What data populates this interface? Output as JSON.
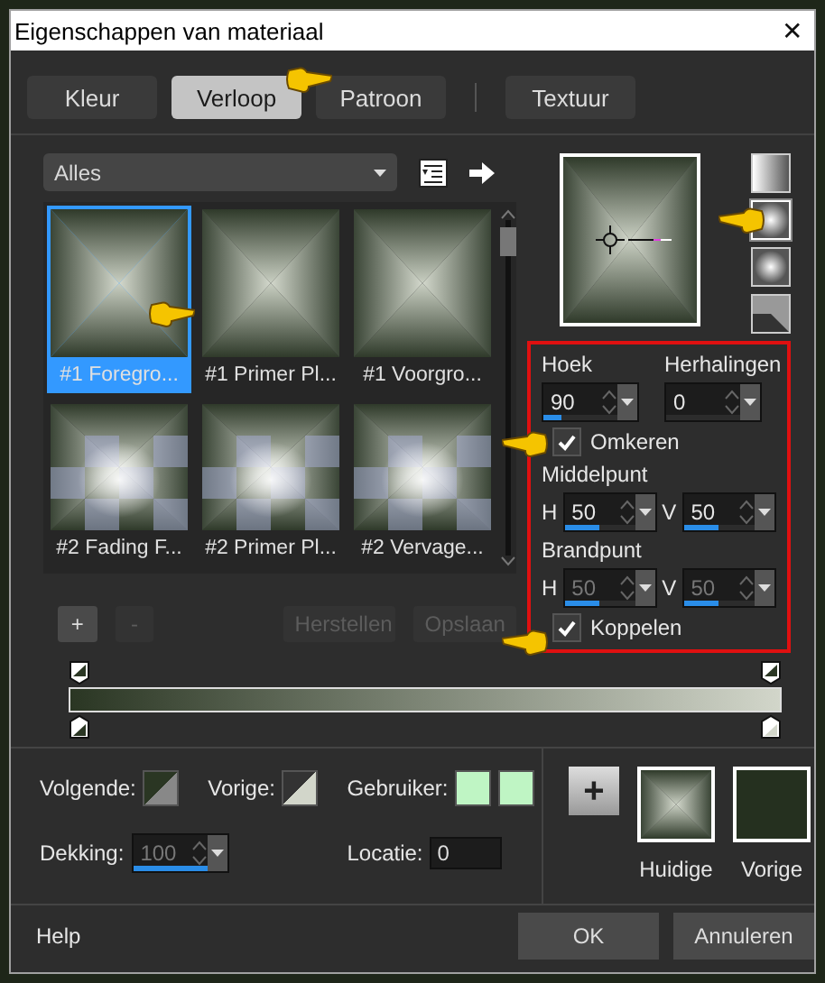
{
  "window": {
    "title": "Eigenschappen van materiaal",
    "close": "✕"
  },
  "tabs": [
    {
      "label": "Kleur",
      "selected": false
    },
    {
      "label": "Verloop",
      "selected": true
    },
    {
      "label": "Patroon",
      "selected": false
    },
    {
      "label": "Textuur",
      "selected": false
    }
  ],
  "gradient_list": {
    "filter": "Alles",
    "items": [
      {
        "label": "#1 Foregro...",
        "selected": true,
        "kind": "rectangular"
      },
      {
        "label": "#1 Primer Pl...",
        "selected": false,
        "kind": "rectangular"
      },
      {
        "label": "#1 Voorgro...",
        "selected": false,
        "kind": "rectangular"
      },
      {
        "label": "#2 Fading F...",
        "selected": false,
        "kind": "checker"
      },
      {
        "label": "#2 Primer Pl...",
        "selected": false,
        "kind": "checker"
      },
      {
        "label": "#2 Vervage...",
        "selected": false,
        "kind": "checker"
      }
    ]
  },
  "list_buttons": [
    {
      "label": "+",
      "disabled": false
    },
    {
      "label": "-",
      "disabled": true
    },
    {
      "label": "Herstellen",
      "disabled": true
    },
    {
      "label": "Opslaan",
      "disabled": true
    }
  ],
  "styles": [
    {
      "kind": "linear",
      "selected": false
    },
    {
      "kind": "rectangular",
      "selected": true
    },
    {
      "kind": "radial",
      "selected": false
    },
    {
      "kind": "sunburst",
      "selected": false
    }
  ],
  "settings": {
    "angle": {
      "label": "Hoek",
      "value": "90",
      "level": 0.25,
      "disabled": false
    },
    "repeats": {
      "label": "Herhalingen",
      "value": "0",
      "level": 0,
      "disabled": false
    },
    "invert": {
      "label": "Omkeren",
      "checked": true
    },
    "center": {
      "label": "Middelpunt",
      "h_label": "H",
      "h": {
        "value": "50",
        "level": 0.5,
        "disabled": false
      },
      "v_label": "V",
      "v": {
        "value": "50",
        "level": 0.5,
        "disabled": false
      }
    },
    "focal": {
      "label": "Brandpunt",
      "h_label": "H",
      "h": {
        "value": "50",
        "level": 0.5,
        "disabled": true
      },
      "v_label": "V",
      "v": {
        "value": "50",
        "level": 0.5,
        "disabled": true
      }
    },
    "link": {
      "label": "Koppelen",
      "checked": true
    }
  },
  "stop": {
    "next_label": "Volgende:",
    "prev_label": "Vorige:",
    "user_label": "Gebruiker:",
    "opacity_label": "Dekking:",
    "opacity": {
      "value": "100",
      "level": 1,
      "disabled": true
    },
    "location_label": "Locatie:",
    "location": "0"
  },
  "current": {
    "add": "+",
    "current_label": "Huidige",
    "previous_label": "Vorige"
  },
  "footer": {
    "help": "Help",
    "ok": "OK",
    "cancel": "Annuleren"
  }
}
